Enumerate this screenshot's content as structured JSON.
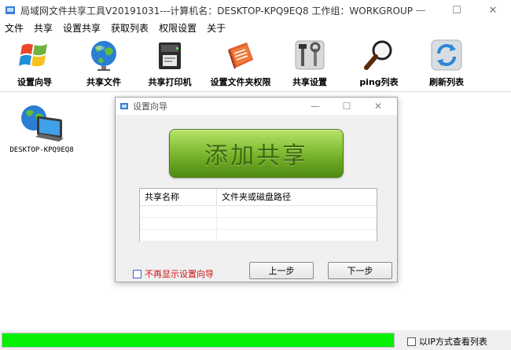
{
  "window": {
    "title": "局域网文件共享工具V20191031---计算机名：DESKTOP-KPQ9EQ8  工作组：WORKGROUP",
    "minimize": "—",
    "maximize": "☐",
    "close": "✕"
  },
  "menu": [
    "文件",
    "共享",
    "设置共享",
    "获取列表",
    "权限设置",
    "关于"
  ],
  "toolbar": [
    {
      "label": "设置向导",
      "icon": "windows-flag-icon"
    },
    {
      "label": "共享文件",
      "icon": "globe-icon"
    },
    {
      "label": "共享打印机",
      "icon": "printer-icon"
    },
    {
      "label": "设置文件夹权限",
      "icon": "folder-permission-icon"
    },
    {
      "label": "共享设置",
      "icon": "tools-icon"
    },
    {
      "label": "ping列表",
      "icon": "magnifier-icon"
    },
    {
      "label": "刷新列表",
      "icon": "refresh-icon"
    }
  ],
  "computers": [
    {
      "name": "DESKTOP-KPQ9EQ8",
      "icon": "network-computer-icon"
    }
  ],
  "dialog": {
    "title": "设置向导",
    "minimize": "—",
    "maximize": "☐",
    "close": "✕",
    "add_button": "添加共享",
    "table": {
      "columns": [
        "共享名称",
        "文件夹或磁盘路径"
      ],
      "rows": [
        [
          "",
          ""
        ],
        [
          "",
          ""
        ],
        [
          "",
          ""
        ]
      ]
    },
    "dont_show_label": "不再显示设置向导",
    "prev_button": "上一步",
    "next_button": "下一步"
  },
  "status": {
    "progress_percent": 100,
    "ip_view_label": "以IP方式查看列表",
    "progress_color": "#06f006"
  }
}
